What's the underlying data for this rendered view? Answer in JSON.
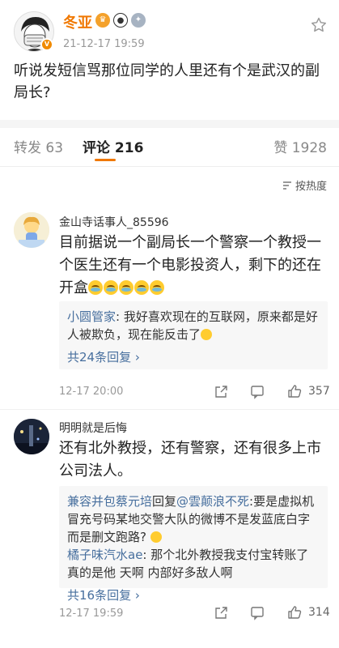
{
  "post": {
    "author": "冬亚",
    "time": "21-12-17 19:59",
    "text": "听说发短信骂那位同学的人里还有个是武汉的副局长?"
  },
  "tabs": {
    "repost": "转发 63",
    "comment": "评论 216",
    "like": "赞 1928"
  },
  "sort_label": "按热度",
  "comments": [
    {
      "user": "金山寺话事人_85596",
      "text": "目前据说一个副局长一个警察一个教授一个医生还有一个电影投资人，剩下的还在开盒",
      "replies": [
        {
          "user": "小圆管家",
          "sep": ":",
          "text": "我好喜欢现在的互联网，原来都是好人被欺负，现在能反击了"
        }
      ],
      "more": "共24条回复 ›",
      "time": "12-17 20:00",
      "likes": "357"
    },
    {
      "user": "明明就是后悔",
      "text": "还有北外教授，还有警察，还有很多上市公司法人。",
      "replies": [
        {
          "user": "兼容并包蔡元培",
          "mid": "回复",
          "target": "@雲颠浪不死",
          "sep": ":",
          "text": "要是虚拟机冒充号码某地交警大队的微博不是发蓝底白字而是删文跑路?"
        },
        {
          "user": "橘子味汽水ae",
          "sep": ":",
          "text": "那个北外教授我支付宝转账了真的是他 天啊 内部好多敌人啊"
        }
      ],
      "more": "共16条回复 ›",
      "time": "12-17 19:59",
      "likes": "314"
    }
  ],
  "colors": {
    "accent": "#f07800",
    "link": "#476f9e"
  }
}
